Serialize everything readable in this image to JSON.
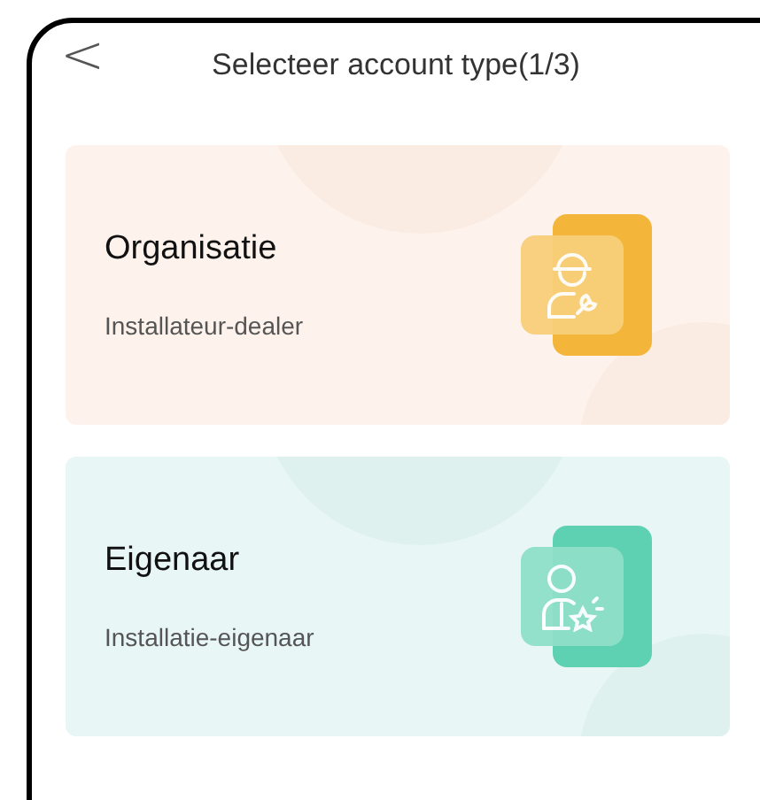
{
  "header": {
    "back": "<",
    "title": "Selecteer account type(1/3)"
  },
  "options": [
    {
      "kind": "installer",
      "title": "Organisatie",
      "subtitle": "Installateur-dealer"
    },
    {
      "kind": "owner",
      "title": "Eigenaar",
      "subtitle": "Installatie-eigenaar"
    }
  ]
}
